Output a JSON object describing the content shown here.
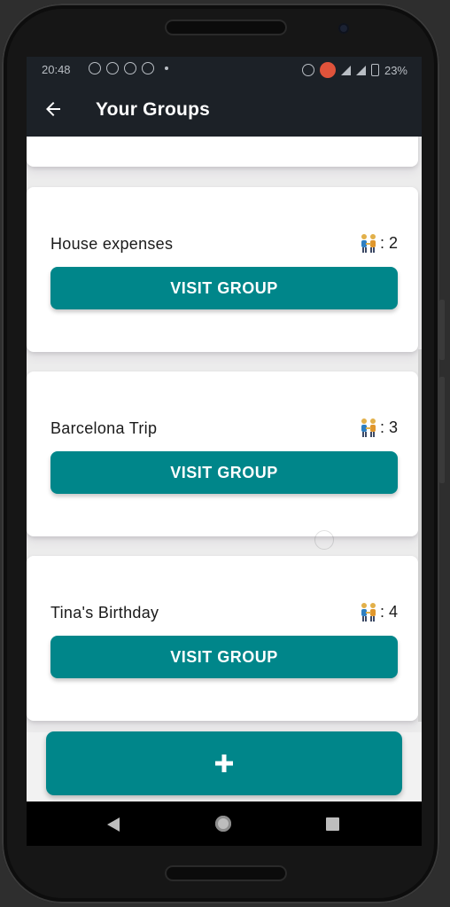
{
  "status_bar": {
    "time": "20:48",
    "battery": "23%"
  },
  "app_bar": {
    "title": "Your Groups"
  },
  "groups": [
    {
      "name": "House expenses",
      "member_count": ": 2",
      "button_label": "VISIT GROUP"
    },
    {
      "name": "Barcelona Trip",
      "member_count": ": 3",
      "button_label": "VISIT GROUP"
    },
    {
      "name": "Tina's Birthday",
      "member_count": ": 4",
      "button_label": "VISIT GROUP"
    }
  ],
  "add_button": {
    "label": "+",
    "icon": "plus-icon"
  },
  "colors": {
    "accent": "#00868a",
    "appbar": "#1c2127",
    "background": "#ececec",
    "card": "#ffffff",
    "recording": "#e0533b"
  },
  "icons": {
    "back": "arrow-left-icon",
    "members": "people-holding-hands-icon",
    "nav_back": "triangle-back-icon",
    "nav_home": "circle-home-icon",
    "nav_recent": "square-recents-icon"
  }
}
